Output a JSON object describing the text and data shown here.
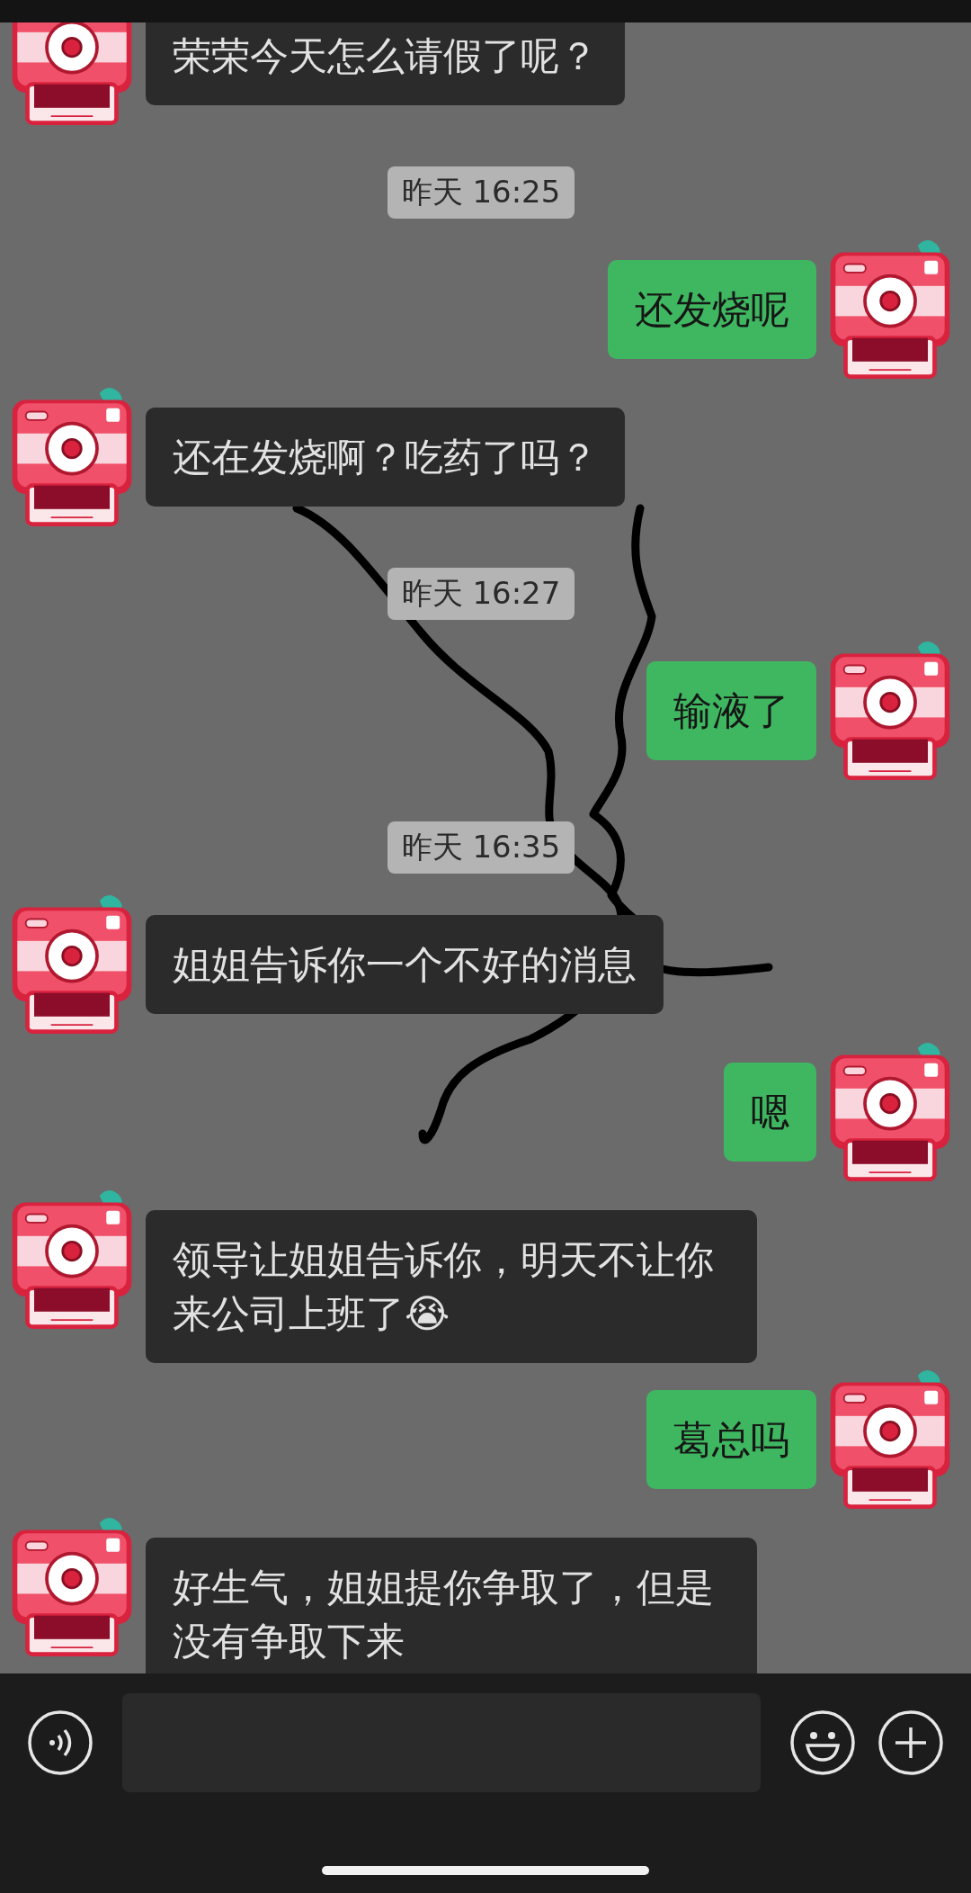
{
  "messages": [
    {
      "kind": "message",
      "outgoing": false,
      "text": "荣荣今天怎么请假了呢？"
    },
    {
      "kind": "time",
      "text": "昨天 16:25"
    },
    {
      "kind": "message",
      "outgoing": true,
      "text": "还发烧呢"
    },
    {
      "kind": "message",
      "outgoing": false,
      "text": "还在发烧啊？吃药了吗？"
    },
    {
      "kind": "time",
      "text": "昨天 16:27"
    },
    {
      "kind": "message",
      "outgoing": true,
      "text": "输液了"
    },
    {
      "kind": "time",
      "text": "昨天 16:35"
    },
    {
      "kind": "message",
      "outgoing": false,
      "text": "姐姐告诉你一个不好的消息"
    },
    {
      "kind": "message",
      "outgoing": true,
      "text": "嗯"
    },
    {
      "kind": "message",
      "outgoing": false,
      "text": "领导让姐姐告诉你，明天不让你来公司上班了😭"
    },
    {
      "kind": "message",
      "outgoing": true,
      "text": "葛总吗"
    },
    {
      "kind": "message",
      "outgoing": false,
      "text": "好生气，姐姐提你争取了，但是没有争取下来"
    }
  ]
}
